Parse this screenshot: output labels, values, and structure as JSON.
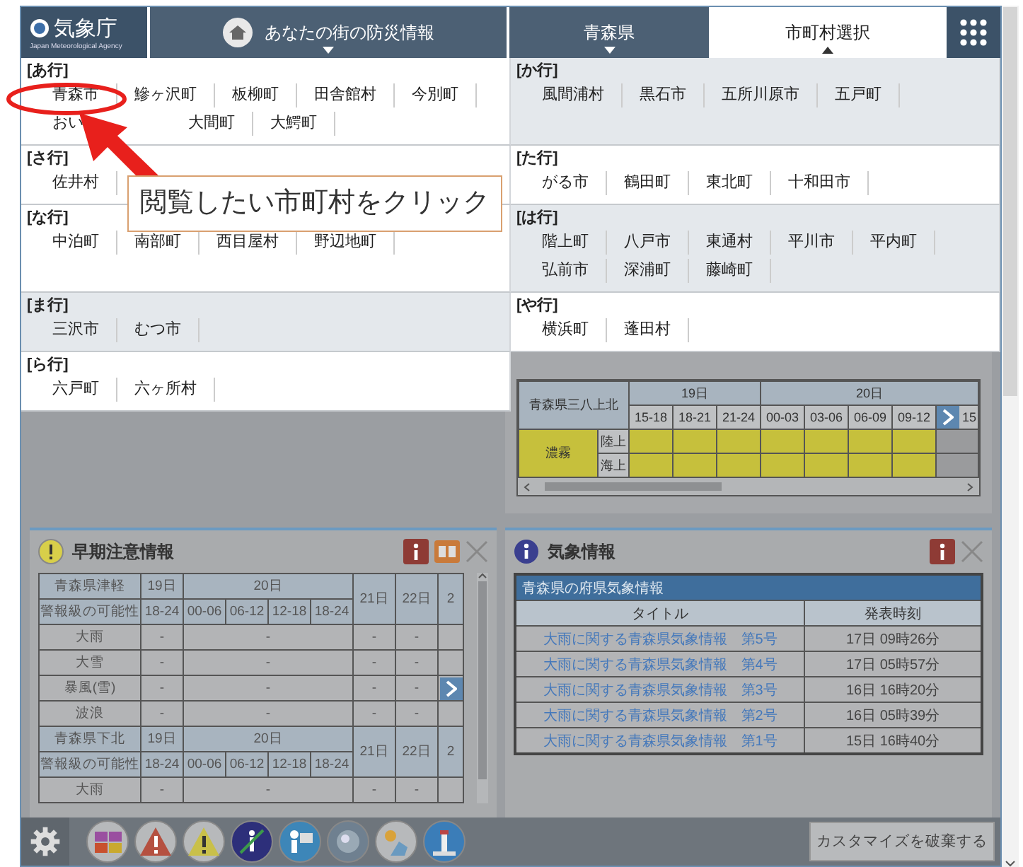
{
  "header": {
    "logo": {
      "title": "気象庁",
      "subtitle": "Japan Meteorological Agency"
    },
    "tabs": [
      {
        "label": "あなたの街の防災情報",
        "kind": "home",
        "selected": false
      },
      {
        "label": "青森県",
        "kind": "menu",
        "selected": false
      },
      {
        "label": "市町村選択",
        "kind": "menu",
        "selected": true
      }
    ]
  },
  "picker": {
    "groups": [
      {
        "heading": "[あ行]",
        "shaded": false,
        "rows": [
          [
            "青森市",
            "鰺ヶ沢町",
            "板柳町",
            "田舎館村",
            "今別町"
          ],
          [
            "おい",
            "大間町",
            "大鰐町"
          ]
        ]
      },
      {
        "heading": "[か行]",
        "shaded": true,
        "rows": [
          [
            "風間浦村",
            "黒石市",
            "五所川原市",
            "五戸町"
          ]
        ]
      },
      {
        "heading": "[さ行]",
        "shaded": false,
        "rows": [
          [
            "佐井村"
          ]
        ]
      },
      {
        "heading": "[た行]",
        "shaded": false,
        "rows": [
          [
            "がる市",
            "鶴田町",
            "東北町",
            "十和田市"
          ]
        ]
      },
      {
        "heading": "[な行]",
        "shaded": false,
        "rows": [
          [
            "中泊町",
            "南部町",
            "西目屋村",
            "野辺地町"
          ]
        ]
      },
      {
        "heading": "[は行]",
        "shaded": true,
        "rows": [
          [
            "階上町",
            "八戸市",
            "東通村",
            "平川市",
            "平内町"
          ],
          [
            "弘前市",
            "深浦町",
            "藤崎町"
          ]
        ]
      },
      {
        "heading": "[ま行]",
        "shaded": true,
        "rows": [
          [
            "三沢市",
            "むつ市"
          ]
        ]
      },
      {
        "heading": "[や行]",
        "shaded": false,
        "rows": [
          [
            "横浜町",
            "蓬田村"
          ]
        ]
      },
      {
        "heading": "[ら行]",
        "shaded": false,
        "rows": [
          [
            "六戸町",
            "六ヶ所村"
          ]
        ]
      }
    ]
  },
  "annotation": {
    "callout": "閲覧したい市町村をクリック"
  },
  "forecast_grid": {
    "region": "青森県三八上北",
    "days": [
      {
        "label": "19日",
        "times": [
          "15-18",
          "18-21",
          "21-24"
        ]
      },
      {
        "label": "20日",
        "times": [
          "00-03",
          "03-06",
          "06-09",
          "09-12",
          "15"
        ]
      }
    ],
    "rows": [
      {
        "label": "濃霧",
        "subrows": [
          {
            "label": "陸上",
            "alerts": [
              true,
              true,
              true,
              true,
              true,
              true,
              true,
              false
            ]
          },
          {
            "label": "海上",
            "alerts": [
              true,
              true,
              true,
              true,
              true,
              true,
              true,
              false
            ]
          }
        ]
      }
    ]
  },
  "early_warning": {
    "title": "早期注意情報",
    "tables": [
      {
        "region": "青森県津軽",
        "subtitle": "警報級の可能性",
        "days": [
          {
            "label": "19日",
            "times": [
              "18-24"
            ]
          },
          {
            "label": "20日",
            "times": [
              "00-06",
              "06-12",
              "12-18",
              "18-24"
            ]
          },
          {
            "label": "21日"
          },
          {
            "label": "22日"
          },
          {
            "label": "2"
          }
        ],
        "rows": [
          {
            "label": "大雨",
            "values": [
              "-",
              "-",
              "-",
              "-"
            ]
          },
          {
            "label": "大雪",
            "values": [
              "-",
              "-",
              "-",
              "-"
            ]
          },
          {
            "label": "暴風(雪)",
            "values": [
              "-",
              "-",
              "-",
              "-"
            ]
          },
          {
            "label": "波浪",
            "values": [
              "-",
              "-",
              "-",
              "-"
            ]
          }
        ]
      },
      {
        "region": "青森県下北",
        "subtitle": "警報級の可能性",
        "days": [
          {
            "label": "19日",
            "times": [
              "18-24"
            ]
          },
          {
            "label": "20日",
            "times": [
              "00-06",
              "06-12",
              "12-18",
              "18-24"
            ]
          },
          {
            "label": "21日"
          },
          {
            "label": "22日"
          },
          {
            "label": "2"
          }
        ],
        "rows": [
          {
            "label": "大雨",
            "values": [
              "-",
              "-",
              "-",
              "-"
            ]
          }
        ]
      }
    ]
  },
  "weather_info": {
    "title": "気象情報",
    "caption": "青森県の府県気象情報",
    "columns": [
      "タイトル",
      "発表時刻"
    ],
    "rows": [
      {
        "title": "大雨に関する青森県気象情報　第5号",
        "time": "17日 09時26分"
      },
      {
        "title": "大雨に関する青森県気象情報　第4号",
        "time": "17日 05時57分"
      },
      {
        "title": "大雨に関する青森県気象情報　第3号",
        "time": "16日 16時20分"
      },
      {
        "title": "大雨に関する青森県気象情報　第2号",
        "time": "16日 05時39分"
      },
      {
        "title": "大雨に関する青森県気象情報　第1号",
        "time": "15日 16時40分"
      }
    ]
  },
  "toolbar": {
    "button": "カスタマイズを破棄する"
  }
}
